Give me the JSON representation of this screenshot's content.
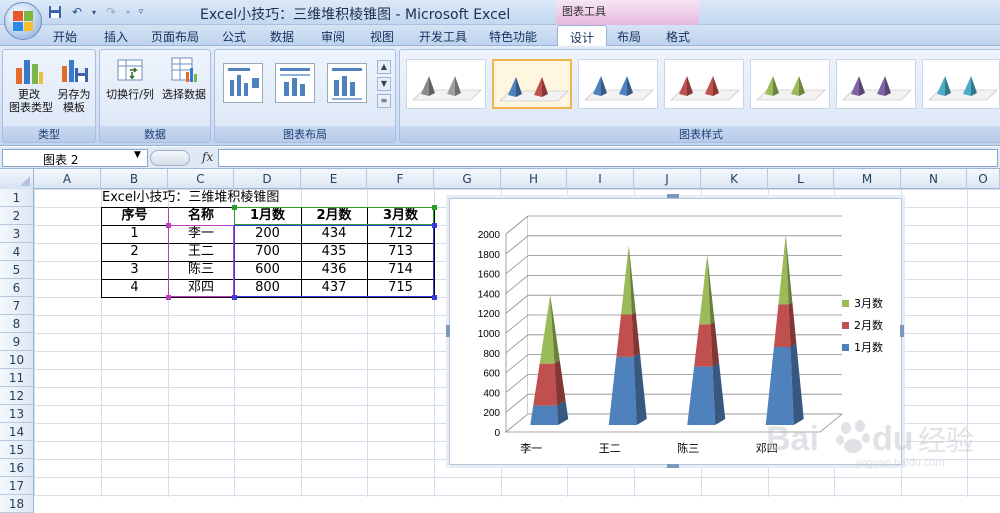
{
  "window": {
    "title": "Excel小技巧：三维堆积棱锥图 - Microsoft Excel",
    "context_tab_group": "图表工具"
  },
  "ribbon_tabs": [
    "开始",
    "插入",
    "页面布局",
    "公式",
    "数据",
    "审阅",
    "视图",
    "开发工具",
    "特色功能",
    "设计",
    "布局",
    "格式"
  ],
  "active_tab": "设计",
  "ribbon": {
    "group_type": {
      "label": "类型",
      "btn1": "更改\n图表类型",
      "btn2": "另存为\n模板"
    },
    "group_data": {
      "label": "数据",
      "btn1": "切换行/列",
      "btn2": "选择数据"
    },
    "group_layout": {
      "label": "图表布局"
    },
    "group_styles": {
      "label": "图表样式"
    }
  },
  "formula_bar": {
    "name_box": "图表 2",
    "fx": "fx",
    "formula": ""
  },
  "columns": [
    "A",
    "B",
    "C",
    "D",
    "E",
    "F",
    "G",
    "H",
    "I",
    "J",
    "K",
    "L",
    "M",
    "N",
    "O"
  ],
  "rows": [
    "1",
    "2",
    "3",
    "4",
    "5",
    "6",
    "7",
    "8",
    "9",
    "10",
    "11",
    "12",
    "13",
    "14",
    "15",
    "16",
    "17",
    "18"
  ],
  "sheet": {
    "title": "Excel小技巧：三维堆积棱锥图",
    "headers": [
      "序号",
      "名称",
      "1月数",
      "2月数",
      "3月数"
    ],
    "rows": [
      [
        "1",
        "李一",
        "200",
        "434",
        "712"
      ],
      [
        "2",
        "王二",
        "700",
        "435",
        "713"
      ],
      [
        "3",
        "陈三",
        "600",
        "436",
        "714"
      ],
      [
        "4",
        "邓四",
        "800",
        "437",
        "715"
      ]
    ]
  },
  "chart_data": {
    "type": "bar",
    "subtype": "3d-stacked-pyramid",
    "categories": [
      "李一",
      "王二",
      "陈三",
      "邓四"
    ],
    "series": [
      {
        "name": "1月数",
        "values": [
          200,
          700,
          600,
          800
        ],
        "color": "#4f81bd"
      },
      {
        "name": "2月数",
        "values": [
          434,
          435,
          436,
          437
        ],
        "color": "#c0504d"
      },
      {
        "name": "3月数",
        "values": [
          712,
          713,
          714,
          715
        ],
        "color": "#9bbb59"
      }
    ],
    "y_ticks": [
      "0",
      "200",
      "400",
      "600",
      "800",
      "1000",
      "1200",
      "1400",
      "1600",
      "1800",
      "2000"
    ],
    "ylim": [
      0,
      2000
    ],
    "legend_position": "right",
    "legend_order": [
      "3月数",
      "2月数",
      "1月数"
    ],
    "grid": true
  },
  "watermark": {
    "brand": "Bai",
    "brand2": "du",
    "cn": "经验",
    "url": "jingyan.baidu.com"
  }
}
